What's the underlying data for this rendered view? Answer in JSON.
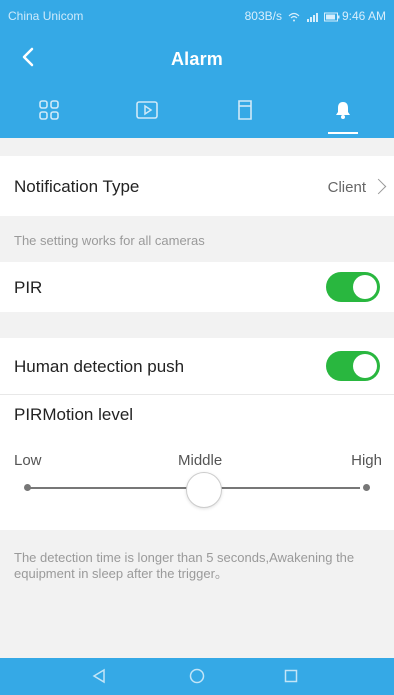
{
  "status": {
    "carrier": "China Unicom",
    "speed": "803B/s",
    "time": "9:46 AM"
  },
  "header": {
    "title": "Alarm",
    "back_icon": "chevron-left-icon"
  },
  "tabs": [
    {
      "icon": "grid-icon",
      "active": false
    },
    {
      "icon": "video-icon",
      "active": false
    },
    {
      "icon": "sd-card-icon",
      "active": false
    },
    {
      "icon": "bell-icon",
      "active": true
    }
  ],
  "settings": {
    "notification": {
      "label": "Notification Type",
      "value": "Client"
    },
    "hint": "The setting works for all cameras",
    "pir": {
      "label": "PIR",
      "enabled": true
    },
    "human_push": {
      "label": "Human detection push",
      "enabled": true
    },
    "motion": {
      "label": "PIRMotion level",
      "levels": [
        "Low",
        "Middle",
        "High"
      ],
      "selected": "Middle"
    },
    "note": "The detection time is longer than 5 seconds,Awakening the equipment in sleep after the trigger。"
  },
  "colors": {
    "accent": "#35a9e6",
    "toggle_on": "#29b73f"
  },
  "navbar": {
    "icons": [
      "back-triangle-icon",
      "home-circle-icon",
      "recent-square-icon"
    ]
  }
}
